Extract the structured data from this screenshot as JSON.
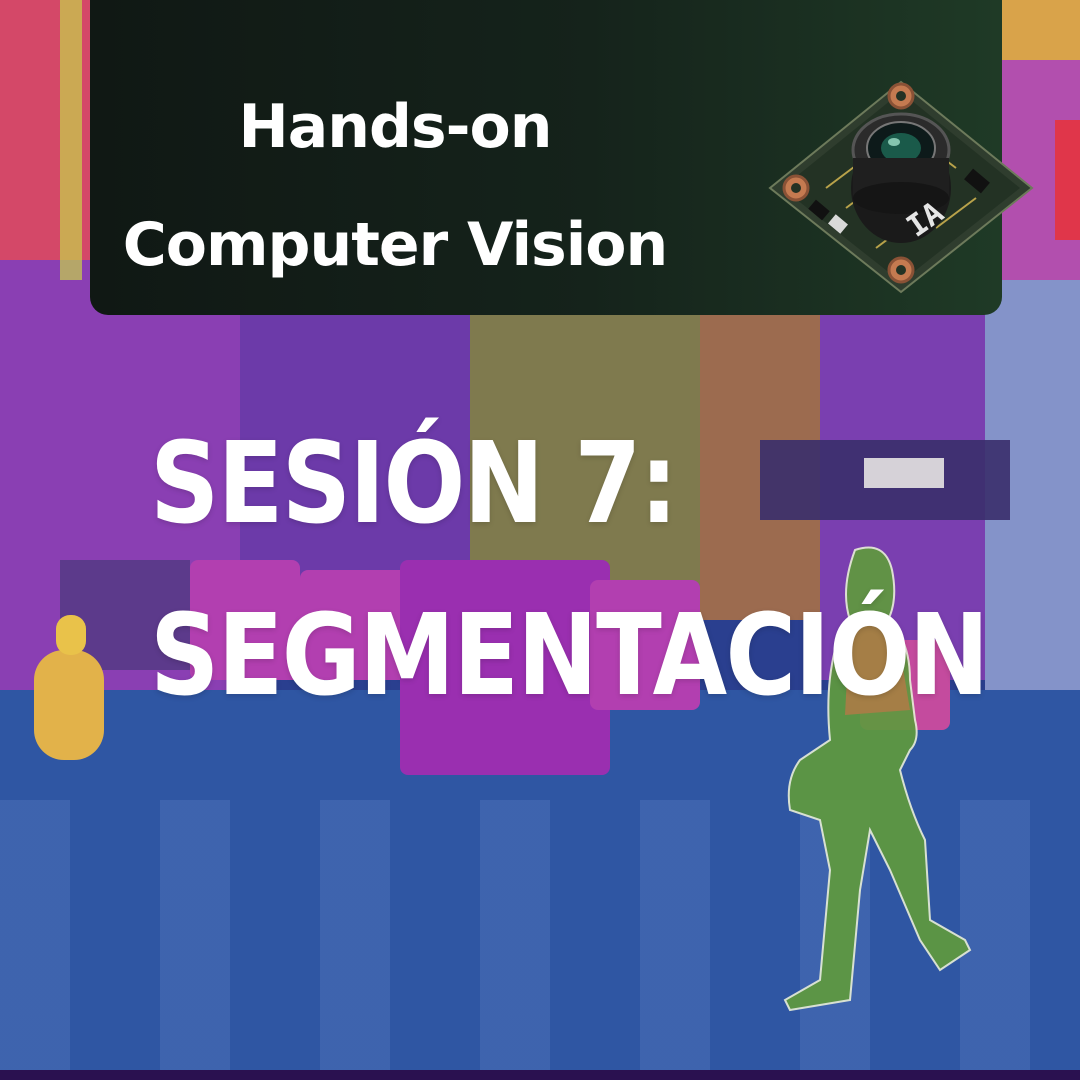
{
  "header": {
    "title_line1": "Hands-on",
    "title_line2": "Computer Vision",
    "logo_icon": "camera-chip-icon",
    "logo_text": "IA"
  },
  "headline": {
    "line1": "SESIÓN 7:",
    "line2": "SEGMENTACIÓN"
  },
  "colors": {
    "panel_bg": "#15231b",
    "road": "#2f56a3",
    "building_purple": "#7a3fb0",
    "car_magenta": "#b23fb0",
    "pedestrian_green": "#5f9a3e",
    "moto_yellow": "#e2b24a",
    "text": "#ffffff"
  }
}
